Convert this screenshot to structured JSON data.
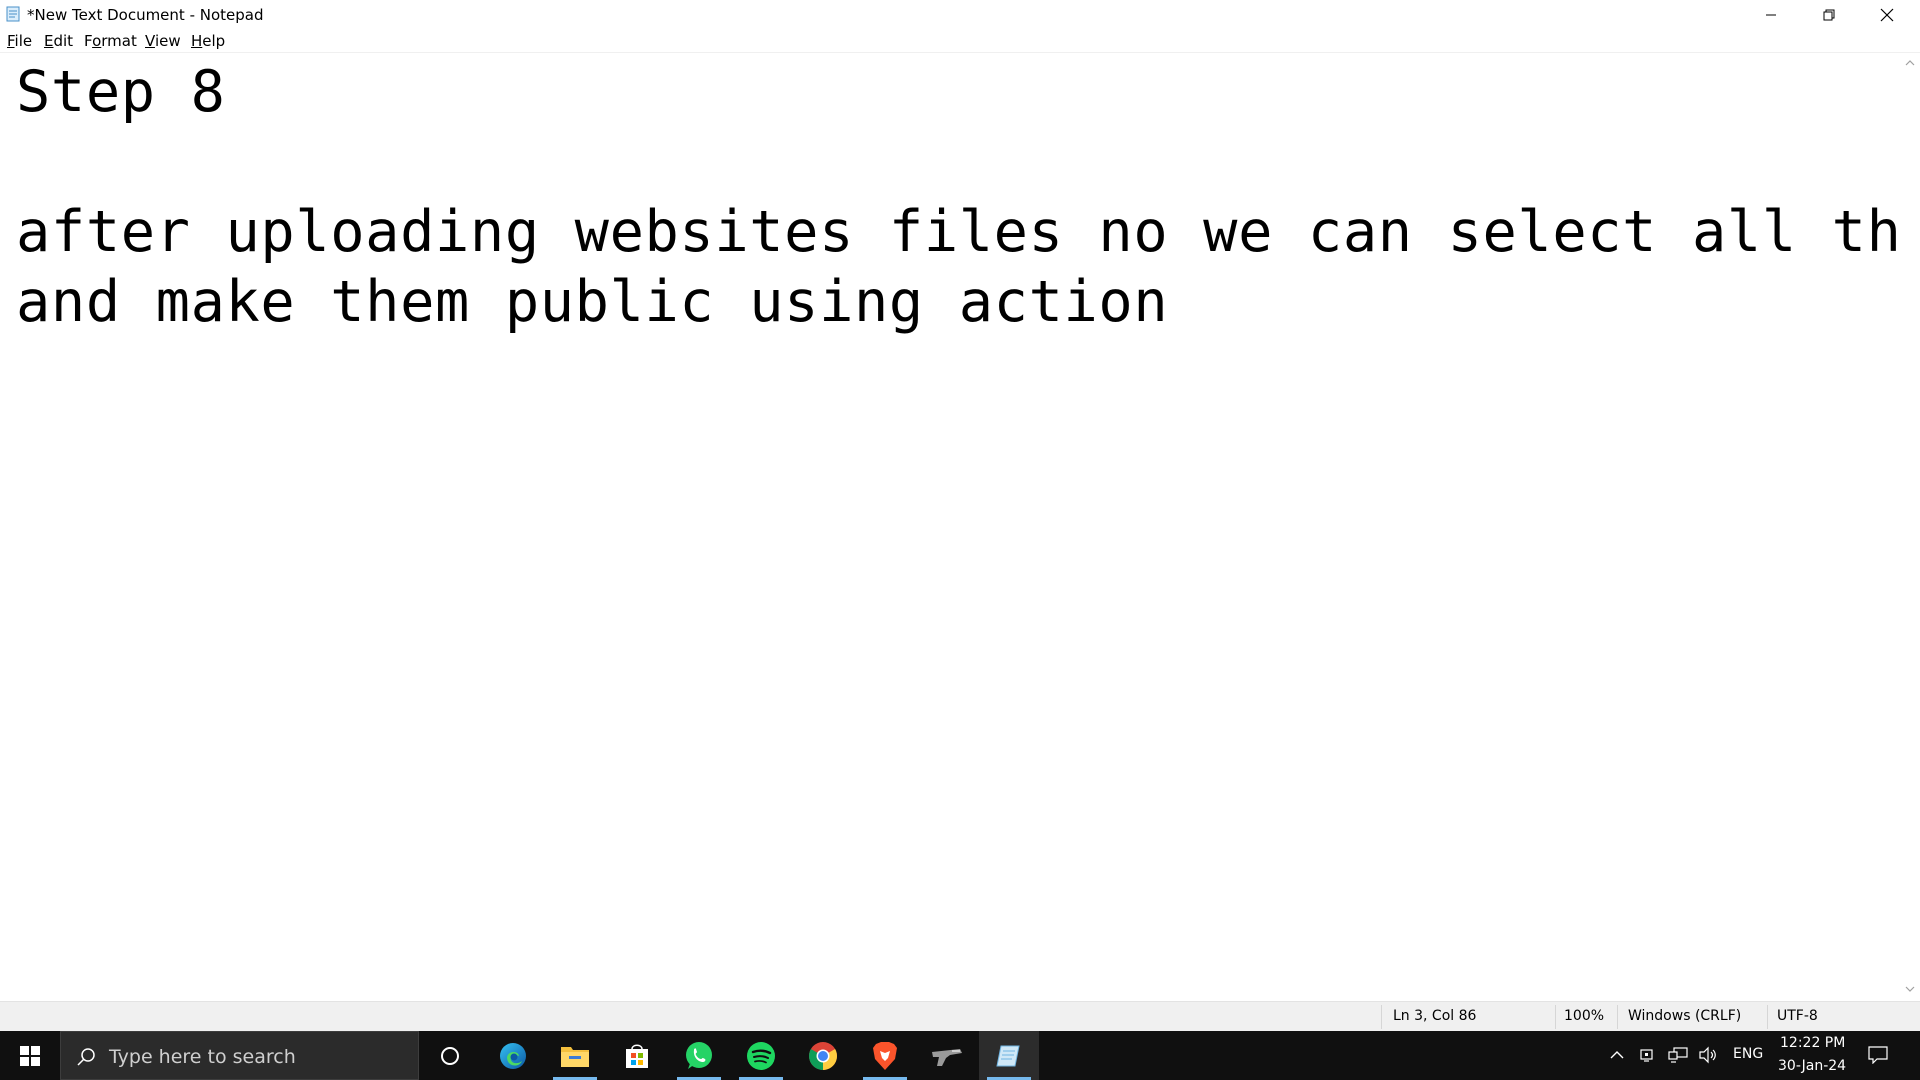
{
  "window": {
    "title": "*New Text Document - Notepad",
    "controls": [
      "minimize",
      "restore",
      "close"
    ]
  },
  "menu": {
    "items": [
      {
        "pre": "",
        "acc": "F",
        "post": "ile"
      },
      {
        "pre": "",
        "acc": "E",
        "post": "dit"
      },
      {
        "pre": "F",
        "acc": "o",
        "post": "rmat"
      },
      {
        "pre": "",
        "acc": "V",
        "post": "iew"
      },
      {
        "pre": "",
        "acc": "H",
        "post": "elp"
      }
    ]
  },
  "editor": {
    "lines": [
      "Step 8",
      "",
      "after uploading websites files no we can select all them",
      "and make them public using action"
    ]
  },
  "status": {
    "position": "Ln 3, Col 86",
    "zoom": "100%",
    "line_ending": "Windows (CRLF)",
    "encoding": "UTF-8"
  },
  "taskbar": {
    "search_placeholder": "Type here to search",
    "apps": [
      "cortana-circle",
      "edge",
      "file-explorer",
      "microsoft-store",
      "whatsapp",
      "spotify",
      "chrome",
      "brave",
      "gun-app",
      "notepad"
    ],
    "tray": {
      "language": "ENG",
      "time": "12:22 PM",
      "date": "30-Jan-24"
    }
  },
  "colors": {
    "taskbar_bg": "#101010",
    "active_underline": "#76b9ed",
    "whatsapp": "#25d366",
    "spotify": "#1ed760"
  }
}
